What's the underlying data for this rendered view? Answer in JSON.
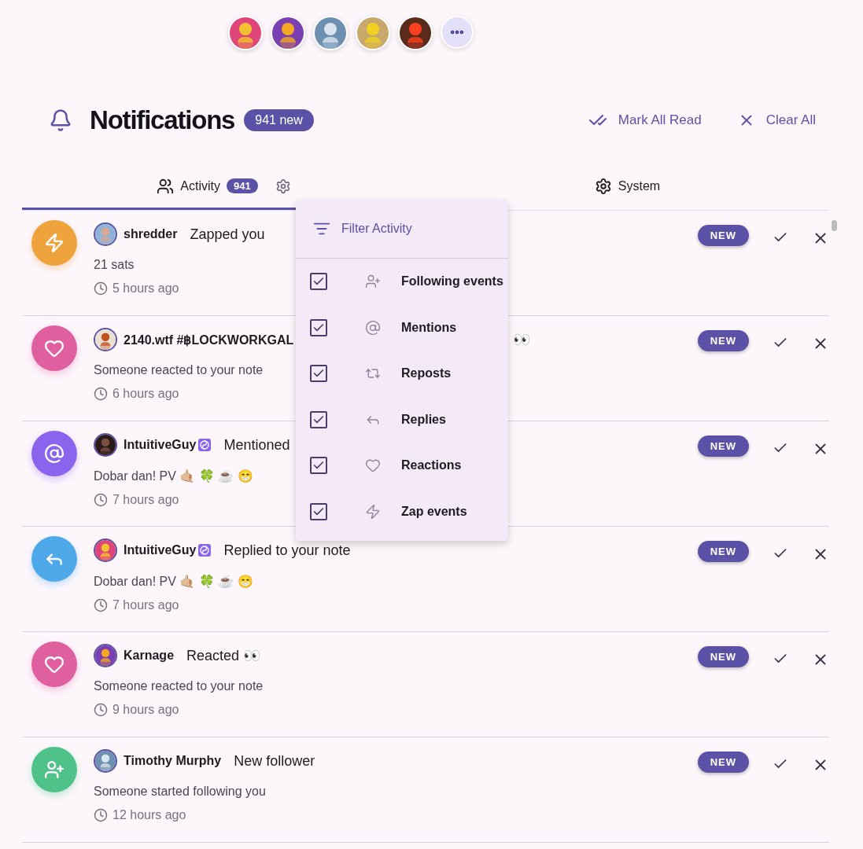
{
  "header": {
    "title": "Notifications",
    "new_count": "941 new",
    "actions": [
      "Mark All Read",
      "Clear All"
    ]
  },
  "tabs": [
    {
      "label": "Activity",
      "count": "941",
      "selected": true
    },
    {
      "label": "System",
      "selected": false
    }
  ],
  "filter_menu": {
    "title": "Filter Activity",
    "items": [
      {
        "kind": "follow",
        "label": "Following events",
        "checked": true
      },
      {
        "kind": "mention",
        "label": "Mentions",
        "checked": true
      },
      {
        "kind": "repost",
        "label": "Reposts",
        "checked": true
      },
      {
        "kind": "reply",
        "label": "Replies",
        "checked": true
      },
      {
        "kind": "reaction",
        "label": "Reactions",
        "checked": true
      },
      {
        "kind": "zap",
        "label": "Zap events",
        "checked": true
      }
    ]
  },
  "notifications": [
    {
      "kind": "zap",
      "name": "shredder",
      "action": "Zapped you",
      "note": "21 sats",
      "time": "5 hours ago",
      "badge": "NEW"
    },
    {
      "kind": "reaction",
      "name": "2140.wtf #฿LOCKWORKGAL",
      "trailing": "👀",
      "note": "Someone reacted to your note",
      "time": "6 hours ago",
      "badge": "NEW"
    },
    {
      "kind": "mention",
      "name": "IntuitiveGuy",
      "verified": true,
      "action": "Mentioned",
      "note": "Dobar dan! PV 🤙🏼 🍀 ☕ 😁",
      "time": "7 hours ago",
      "badge": "NEW"
    },
    {
      "kind": "reply",
      "name": "IntuitiveGuy",
      "verified": true,
      "action": "Replied to your note",
      "note": "Dobar dan! PV 🤙🏼 🍀 ☕ 😁",
      "time": "7 hours ago",
      "badge": "NEW"
    },
    {
      "kind": "reaction",
      "name": "Karnage",
      "action": "Reacted 👀",
      "note": "Someone reacted to your note",
      "time": "9 hours ago",
      "badge": "NEW"
    },
    {
      "kind": "follow",
      "name": "Timothy Murphy",
      "action": "New follower",
      "note": "Someone started following you",
      "time": "12 hours ago",
      "badge": "NEW"
    }
  ]
}
